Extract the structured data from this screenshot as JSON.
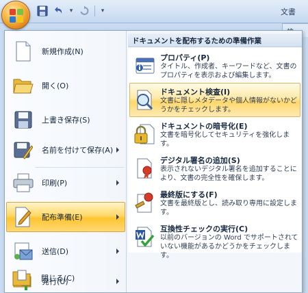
{
  "window": {
    "title_fragment": "文書",
    "ribbon_tab_fragment": "校"
  },
  "quick_access": {
    "items": [
      {
        "name": "save-icon"
      },
      {
        "name": "undo-icon"
      },
      {
        "name": "redo-icon"
      }
    ],
    "customize_glyph": "▾"
  },
  "main_menu": {
    "items": [
      {
        "label": "新規作成(N)",
        "icon": "new-document-icon"
      },
      {
        "label": "開く(O)",
        "icon": "open-folder-icon"
      },
      {
        "label": "上書き保存(S)",
        "icon": "save-icon"
      },
      {
        "label": "名前を付けて保存(A)",
        "icon": "save-as-icon",
        "has_submenu": true
      },
      {
        "label": "印刷(P)",
        "icon": "printer-icon",
        "has_submenu": true
      },
      {
        "label": "配布準備(E)",
        "icon": "prepare-icon",
        "has_submenu": true,
        "active": true
      },
      {
        "label": "送信(D)",
        "icon": "send-icon",
        "has_submenu": true
      },
      {
        "label": "発行(U)",
        "icon": "publish-icon",
        "has_submenu": true
      },
      {
        "label": "閉じる(C)",
        "icon": "close-folder-icon"
      }
    ]
  },
  "submenu": {
    "header": "ドキュメントを配布するための準備作業",
    "items": [
      {
        "title": "プロパティ(P)",
        "description": "タイトル、作成者、キーワードなど、文書のプロパティを表示および編集します。",
        "icon": "properties-icon"
      },
      {
        "title": "ドキュメント検査(I)",
        "description": "文書に隠しメタデータや個人情報がないかどうかをチェックします。",
        "icon": "inspect-document-icon",
        "active": true
      },
      {
        "title": "ドキュメントの暗号化(E)",
        "description": "文書を暗号化してセキュリティを強化します。",
        "icon": "encrypt-icon"
      },
      {
        "title": "デジタル署名の追加(S)",
        "description": "表示されないデジタル署名を追加することにより、文書の完全性を確保します。",
        "icon": "digital-signature-icon"
      },
      {
        "title": "最終版にする(F)",
        "description": "文書を最終版とし、読み取り専用に設定します。",
        "icon": "mark-final-icon"
      },
      {
        "title": "互換性チェックの実行(C)",
        "description": "以前のバージョンの Word でサポートされていない機能があるかどうかをチェックします。",
        "icon": "compatibility-checker-icon"
      }
    ]
  },
  "colors": {
    "highlight": "#ffd867",
    "menu_border": "#8ba6c9",
    "office_orange": "#f7b23b"
  }
}
